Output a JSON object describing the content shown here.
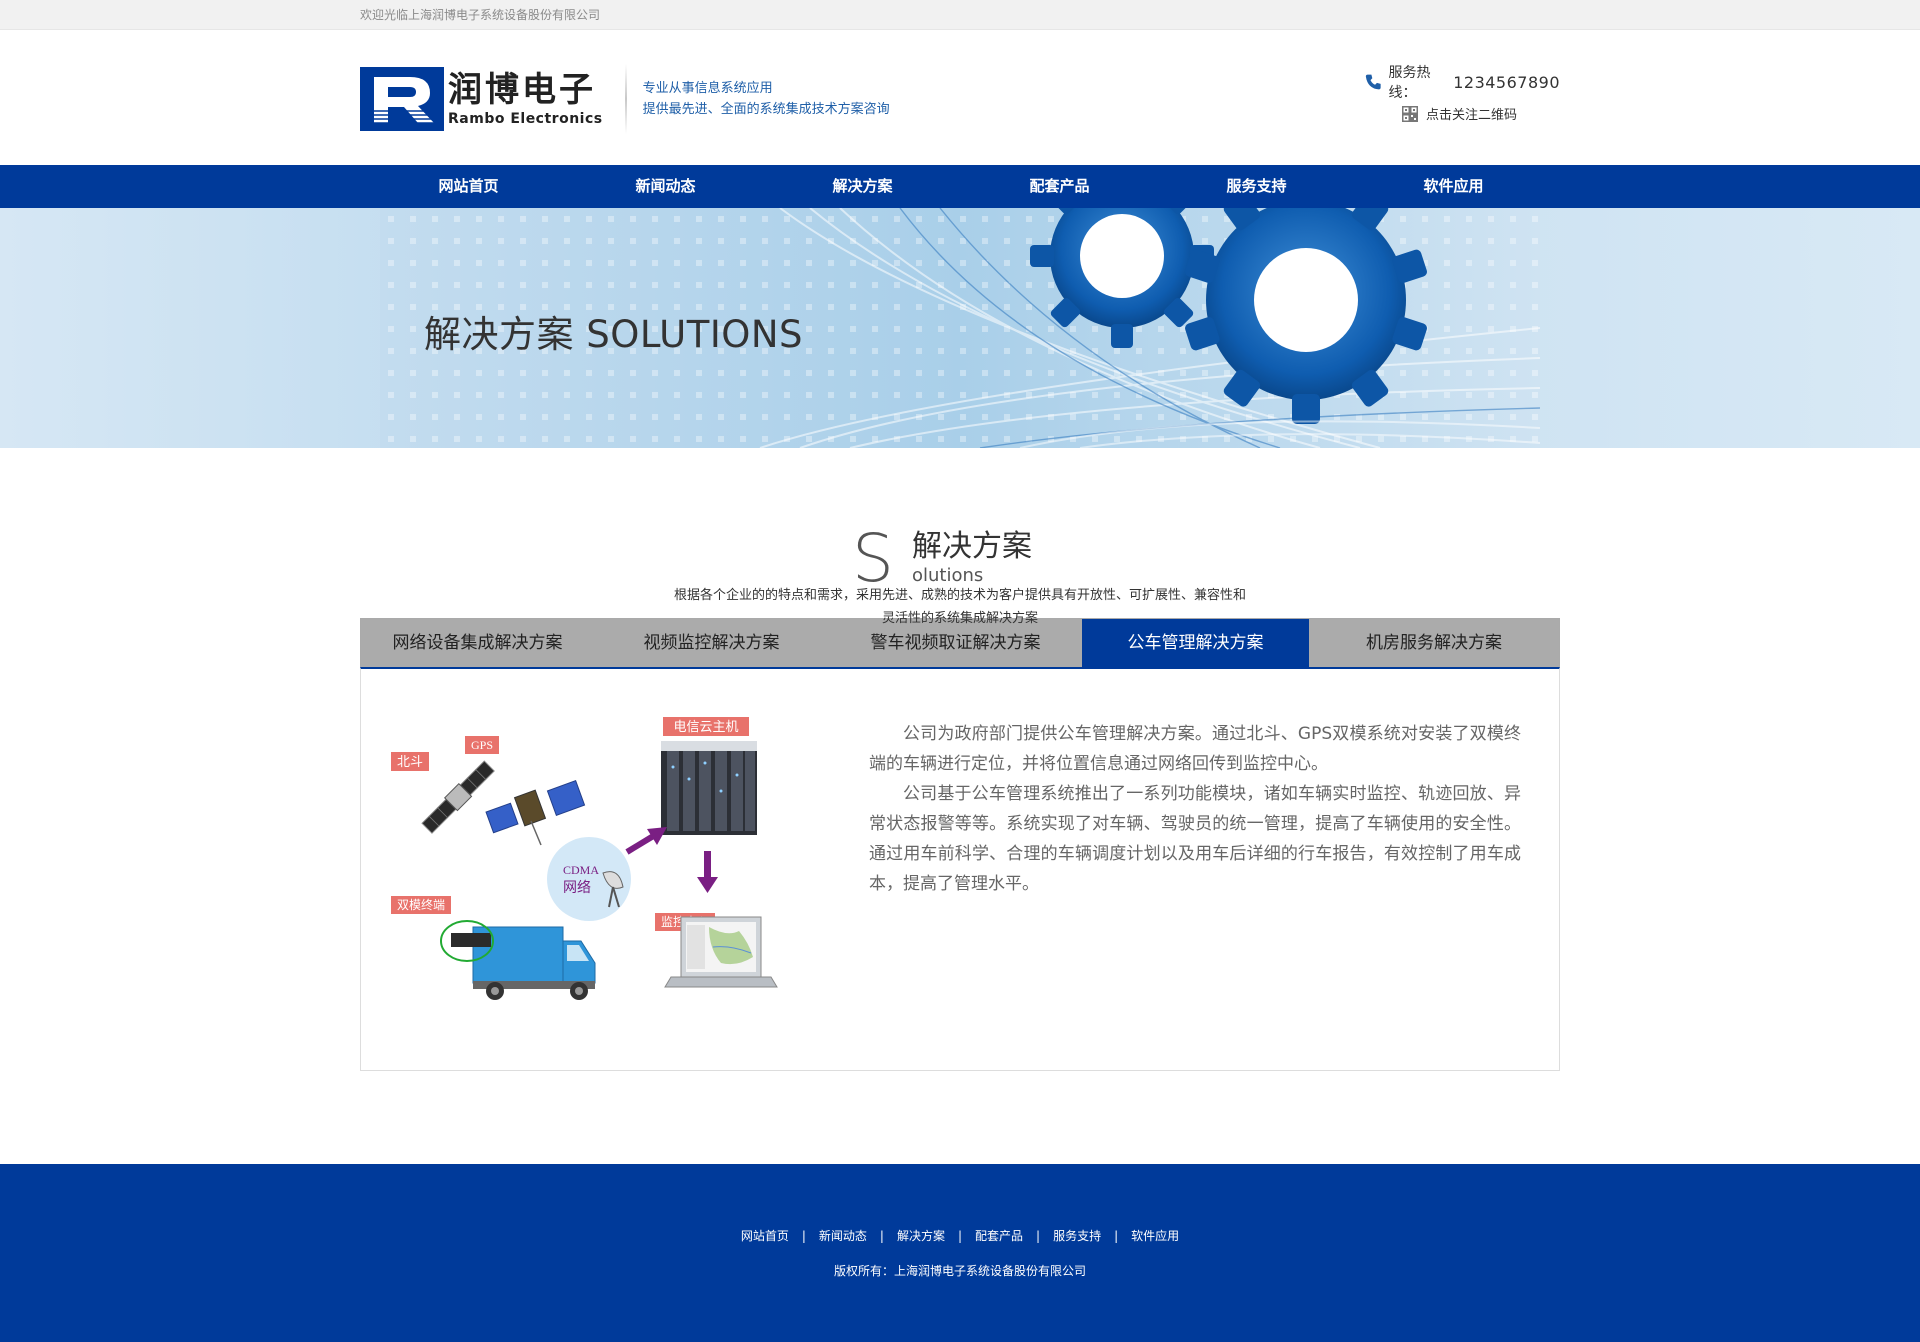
{
  "topbar": {
    "welcome": "欢迎光临上海润博电子系统设备股份有限公司"
  },
  "header": {
    "logo_cn": "润博电子",
    "logo_en": "Rambo Electronics",
    "slogan_line1": "专业从事信息系统应用",
    "slogan_line2": "提供最先进、全面的系统集成技术方案咨询",
    "hotline_label": "服务热线：",
    "hotline_number": "1234567890",
    "qr_label": "点击关注二维码"
  },
  "nav": {
    "items": [
      {
        "label": "网站首页"
      },
      {
        "label": "新闻动态"
      },
      {
        "label": "解决方案"
      },
      {
        "label": "配套产品"
      },
      {
        "label": "服务支持"
      },
      {
        "label": "软件应用"
      }
    ]
  },
  "banner": {
    "title": "解决方案 SOLUTIONS"
  },
  "section": {
    "letter": "S",
    "title_cn": "解决方案",
    "title_en": "olutions",
    "description": "根据各个企业的的特点和需求，采用先进、成熟的技术为客户提供具有开放性、可扩展性、兼容性和灵活性的系统集成解决方案"
  },
  "tabs": [
    {
      "label": "网络设备集成解决方案",
      "active": false
    },
    {
      "label": "视频监控解决方案",
      "active": false
    },
    {
      "label": "警车视频取证解决方案",
      "active": false
    },
    {
      "label": "公车管理解决方案",
      "active": true
    },
    {
      "label": "机房服务解决方案",
      "active": false
    }
  ],
  "diagram": {
    "labels": {
      "beidou": "北斗",
      "gps": "GPS",
      "cloud_host": "电信云主机",
      "cdma_line1": "CDMA",
      "cdma_line2": "网络",
      "dual_terminal": "双模终端",
      "monitor_center": "监控中心"
    }
  },
  "content": {
    "paragraph1": "公司为政府部门提供公车管理解决方案。通过北斗、GPS双模系统对安装了双模终端的车辆进行定位，并将位置信息通过网络回传到监控中心。",
    "paragraph2": "公司基于公车管理系统推出了一系列功能模块，诸如车辆实时监控、轨迹回放、异常状态报警等等。系统实现了对车辆、驾驶员的统一管理，提高了车辆使用的安全性。通过用车前科学、合理的车辆调度计划以及用车后详细的行车报告，有效控制了用车成本，提高了管理水平。"
  },
  "footer": {
    "links": [
      {
        "label": "网站首页"
      },
      {
        "label": "新闻动态"
      },
      {
        "label": "解决方案"
      },
      {
        "label": "配套产品"
      },
      {
        "label": "服务支持"
      },
      {
        "label": "软件应用"
      }
    ],
    "separator": "|",
    "copyright": "版权所有：上海润博电子系统设备股份有限公司"
  },
  "colors": {
    "brand_blue": "#003a9a",
    "tab_gray": "#ababab",
    "label_red": "#e8726b",
    "arrow_purple": "#7a1f83"
  }
}
